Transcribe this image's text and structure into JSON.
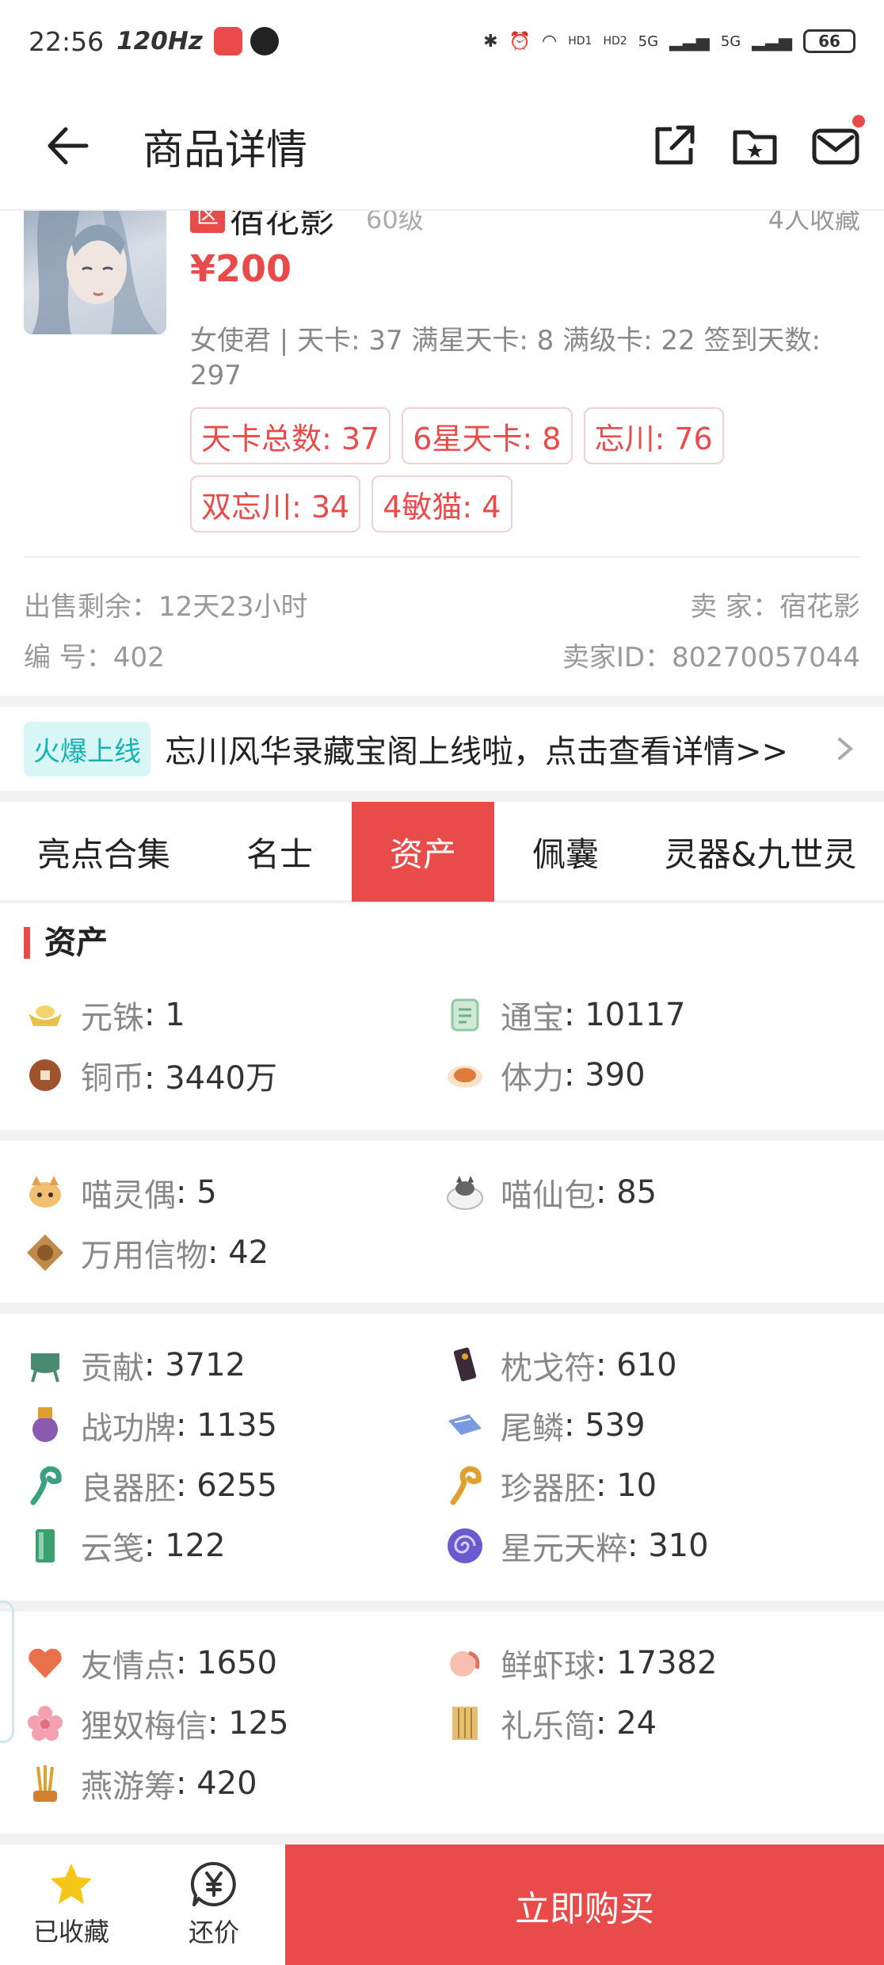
{
  "status_bar": {
    "time": "22:56",
    "refresh_rate": "120Hz",
    "network_labels": [
      "HD1",
      "HD2",
      "5G",
      "5G"
    ],
    "battery": "66"
  },
  "nav": {
    "title": "商品详情"
  },
  "product": {
    "server_tag": "区",
    "seller_name_top": "宿花影",
    "level": "60级",
    "favorites": "4人收藏",
    "price": "¥200",
    "summary": "女使君 | 天卡: 37 满星天卡: 8 满级卡: 22 签到天数: 297",
    "tags": [
      "天卡总数: 37",
      "6星天卡: 8",
      "忘川: 76",
      "双忘川: 34",
      "4敏猫: 4"
    ],
    "remaining": "出售剩余：12天23小时",
    "seller": "卖  家：宿花影",
    "number": "编  号：402",
    "seller_id": "卖家ID：80270057044"
  },
  "notice": {
    "badge": "火爆上线",
    "text": "忘川风华录藏宝阁上线啦，点击查看详情>>"
  },
  "tabs": [
    {
      "label": "亮点合集",
      "active": false
    },
    {
      "label": "名士",
      "active": false
    },
    {
      "label": "资产",
      "active": true
    },
    {
      "label": "佩囊",
      "active": false
    },
    {
      "label": "灵器&九世灵",
      "active": false
    }
  ],
  "assets": {
    "title": "资产",
    "group1": [
      {
        "label": "元铢",
        "value": ": 1",
        "icon": "gold-ingot-icon",
        "color": "#e8c14a"
      },
      {
        "label": "通宝",
        "value": ": 10117",
        "icon": "jade-token-icon",
        "color": "#8fc9a0"
      },
      {
        "label": "铜币",
        "value": ": 3440万",
        "icon": "copper-coin-icon",
        "color": "#a0522d"
      },
      {
        "label": "体力",
        "value": ": 390",
        "icon": "stamina-bowl-icon",
        "color": "#e07a3a"
      }
    ],
    "group2": [
      {
        "label": "喵灵偶",
        "value": ": 5",
        "icon": "cat-doll-icon",
        "color": "#e0a050"
      },
      {
        "label": "喵仙包",
        "value": ": 85",
        "icon": "cat-bun-icon",
        "color": "#8a8f9a"
      },
      {
        "label": "万用信物",
        "value": ": 42",
        "icon": "token-icon",
        "color": "#8b5a2b"
      }
    ],
    "group3": [
      {
        "label": "贡献",
        "value": ": 3712",
        "icon": "tripod-icon",
        "color": "#4a8a70"
      },
      {
        "label": "枕戈符",
        "value": ": 610",
        "icon": "talisman-icon",
        "color": "#3a2a3a"
      },
      {
        "label": "战功牌",
        "value": ": 1135",
        "icon": "medal-icon",
        "color": "#8a5ab0"
      },
      {
        "label": "尾鳞",
        "value": ": 539",
        "icon": "scale-icon",
        "color": "#5a7ad0"
      },
      {
        "label": "良器胚",
        "value": ": 6255",
        "icon": "green-ruyi-icon",
        "color": "#3aa080"
      },
      {
        "label": "珍器胚",
        "value": ": 10",
        "icon": "gold-ruyi-icon",
        "color": "#e0a030"
      },
      {
        "label": "云笺",
        "value": ": 122",
        "icon": "jade-slip-icon",
        "color": "#3aa070"
      },
      {
        "label": "星元天粹",
        "value": ": 310",
        "icon": "swirl-icon",
        "color": "#6a5ad0"
      }
    ],
    "group4": [
      {
        "label": "友情点",
        "value": ": 1650",
        "icon": "heart-icon",
        "color": "#e8704a"
      },
      {
        "label": "鲜虾球",
        "value": ": 17382",
        "icon": "shrimp-ball-icon",
        "color": "#f09080"
      },
      {
        "label": "狸奴梅信",
        "value": ": 125",
        "icon": "plum-blossom-icon",
        "color": "#f08a9a"
      },
      {
        "label": "礼乐简",
        "value": ": 24",
        "icon": "bamboo-slip-icon",
        "color": "#d0a040"
      },
      {
        "label": "燕游筹",
        "value": ": 420",
        "icon": "lot-sticks-icon",
        "color": "#d08030"
      }
    ]
  },
  "bottom": {
    "favorite_label": "已收藏",
    "bargain_label": "还价",
    "buy_label": "立即购买"
  },
  "colors": {
    "accent": "#e94b4b",
    "teal": "#14b3b3"
  }
}
